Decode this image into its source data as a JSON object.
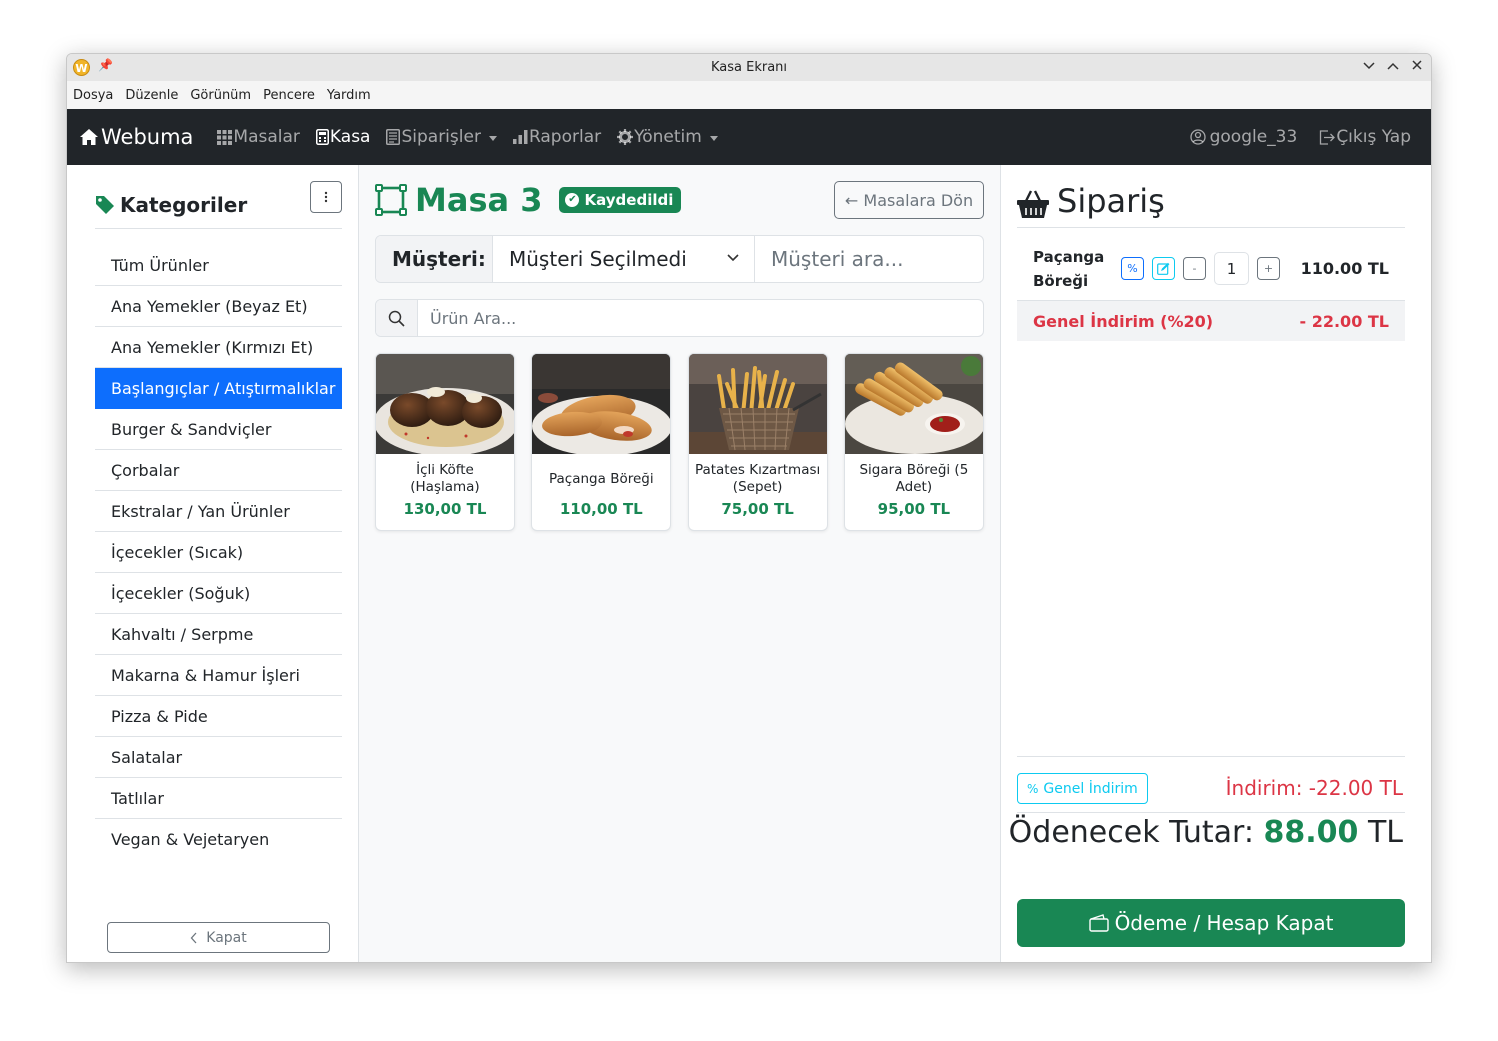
{
  "window": {
    "title": "Kasa Ekranı"
  },
  "menubar": [
    "Dosya",
    "Düzenle",
    "Görünüm",
    "Pencere",
    "Yardım"
  ],
  "navbar": {
    "brand": "Webuma",
    "items": [
      {
        "label": "Masalar",
        "icon": "grid-icon"
      },
      {
        "label": "Kasa",
        "icon": "calculator-icon"
      },
      {
        "label": "Siparişler",
        "icon": "list-icon"
      },
      {
        "label": "Raporlar",
        "icon": "bar-chart-icon"
      },
      {
        "label": "Yönetim",
        "icon": "gear-icon"
      }
    ],
    "user": "google_33",
    "logout": "Çıkış Yap"
  },
  "sidebar": {
    "title": "Kategoriler",
    "categories": [
      "Tüm Ürünler",
      "Ana Yemekler (Beyaz Et)",
      "Ana Yemekler (Kırmızı Et)",
      "Başlangıçlar / Atıştırmalıklar",
      "Burger & Sandviçler",
      "Çorbalar",
      "Ekstralar / Yan Ürünler",
      "İçecekler (Sıcak)",
      "İçecekler (Soğuk)",
      "Kahvaltı / Serpme",
      "Makarna & Hamur İşleri",
      "Pizza & Pide",
      "Salatalar",
      "Tatlılar",
      "Vegan & Vejetaryen"
    ],
    "active_index": 3,
    "collapse_label": "Kapat"
  },
  "main": {
    "table_name": "Masa 3",
    "status_badge": "Kaydedildi",
    "back_button": "← Masalara Dön",
    "customer": {
      "label": "Müşteri:",
      "selected": "Müşteri Seçilmedi",
      "search_placeholder": "Müşteri ara..."
    },
    "product_search_placeholder": "Ürün Ara...",
    "products": [
      {
        "name": "İçli Köfte (Haşlama)",
        "price": "130,00 TL"
      },
      {
        "name": "Paçanga Böreği",
        "price": "110,00 TL"
      },
      {
        "name": "Patates Kızartması (Sepet)",
        "price": "75,00 TL"
      },
      {
        "name": "Sigara Böreği (5 Adet)",
        "price": "95,00 TL"
      }
    ]
  },
  "order": {
    "title": "Sipariş",
    "items": [
      {
        "name": "Paçanga Böreği",
        "qty": "1",
        "price": "110.00 TL"
      }
    ],
    "discount_row": {
      "label": "Genel İndirim (%20)",
      "amount": "- 22.00 TL"
    },
    "general_discount_button": "Genel İndirim",
    "discount_total": "İndirim: -22.00 TL",
    "payable_label": "Ödenecek Tutar:",
    "payable_amount": "88.00",
    "payable_currency": "TL",
    "pay_button": "Ödeme / Hesap Kapat"
  },
  "colors": {
    "success": "#198754",
    "primary": "#0d6efd",
    "danger": "#dc3545",
    "info": "#0dcaf0",
    "navbar": "#212529"
  }
}
